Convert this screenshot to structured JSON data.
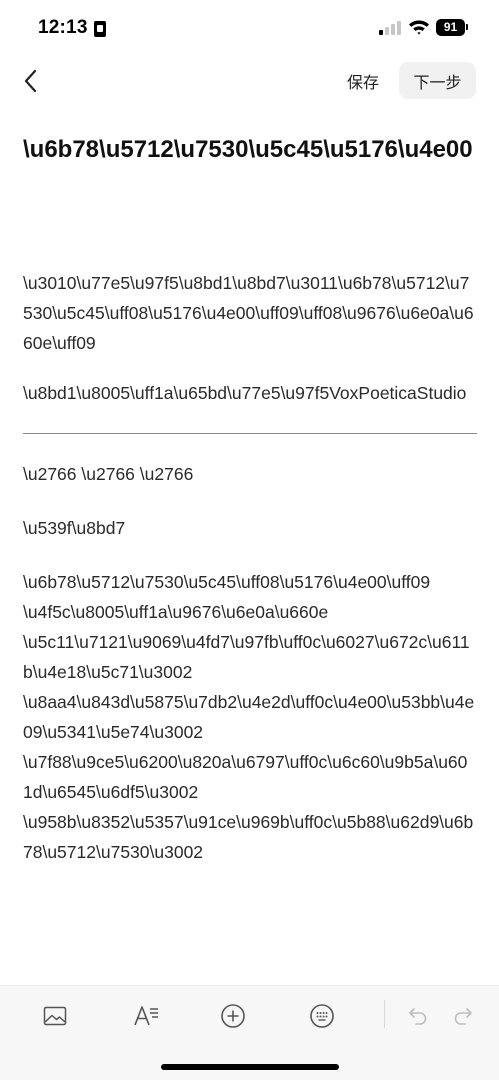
{
  "status_bar": {
    "time": "12:13",
    "battery": "91",
    "icons": [
      "sim-card-icon",
      "cellular-signal-icon",
      "wifi-icon",
      "battery-icon"
    ]
  },
  "nav": {
    "back_icon": "chevron-left-icon",
    "save_label": "保存",
    "next_label": "下一步"
  },
  "document": {
    "title": "\\u6b78\\u5712\\u7530\\u5c45\\u5176\\u4e00",
    "subtitle": "\\u3010\\u77e5\\u97f5\\u8bd1\\u8bd7\\u3011\\u6b78\\u5712\\u7530\\u5c45\\uff08\\u5176\\u4e00\\uff09\\uff08\\u9676\\u6e0a\\u660e\\uff09",
    "author_line": "\\u8bd1\\u8005\\uff1a\\u65bd\\u77e5\\u97f5VoxPoeticaStudio",
    "ornaments": "\\u2766 \\u2766 \\u2766",
    "section_label": "\\u539f\\u8bd7",
    "poem_lines": [
      "\\u6b78\\u5712\\u7530\\u5c45\\uff08\\u5176\\u4e00\\uff09",
      "\\u4f5c\\u8005\\uff1a\\u9676\\u6e0a\\u660e",
      "\\u5c11\\u7121\\u9069\\u4fd7\\u97fb\\uff0c\\u6027\\u672c\\u611b\\u4e18\\u5c71\\u3002",
      "\\u8aa4\\u843d\\u5875\\u7db2\\u4e2d\\uff0c\\u4e00\\u53bb\\u4e09\\u5341\\u5e74\\u3002",
      "\\u7f88\\u9ce5\\u6200\\u820a\\u6797\\uff0c\\u6c60\\u9b5a\\u601d\\u6545\\u6df5\\u3002",
      "\\u958b\\u8352\\u5357\\u91ce\\u969b\\uff0c\\u5b88\\u62d9\\u6b78\\u5712\\u7530\\u3002"
    ]
  },
  "toolbar": {
    "items": [
      "image-icon",
      "text-format-icon",
      "add-circle-icon",
      "keyboard-icon",
      "undo-icon",
      "redo-icon"
    ]
  }
}
